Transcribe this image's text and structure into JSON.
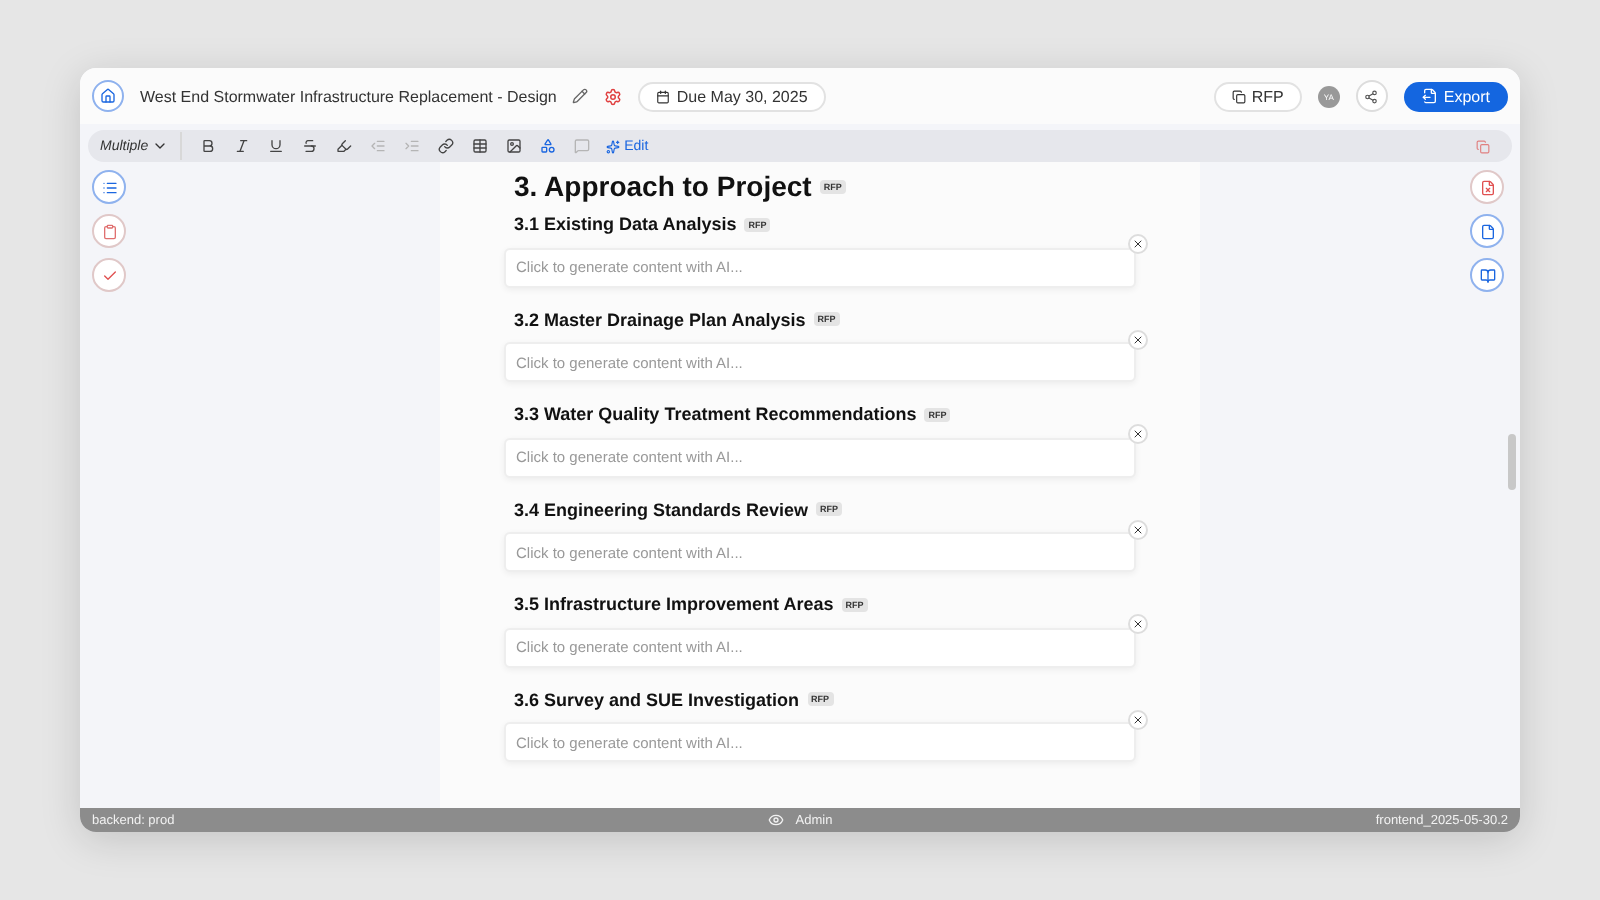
{
  "header": {
    "title": "West End Stormwater Infrastructure Replacement - Design",
    "due": "Due May 30, 2025",
    "rfp_button": "RFP",
    "avatar": "YA",
    "export_button": "Export"
  },
  "toolbar": {
    "style_select": "Multiple",
    "tools": [
      {
        "kind": "bold",
        "disabled": false
      },
      {
        "kind": "italic",
        "disabled": false
      },
      {
        "kind": "underline",
        "disabled": false
      },
      {
        "kind": "strike",
        "disabled": false
      },
      {
        "kind": "highlight",
        "disabled": false
      },
      {
        "kind": "outdent",
        "disabled": true
      },
      {
        "kind": "indent",
        "disabled": true
      },
      {
        "kind": "link",
        "disabled": false
      },
      {
        "kind": "table",
        "disabled": false
      },
      {
        "kind": "image",
        "disabled": false
      },
      {
        "kind": "shapes",
        "disabled": false
      },
      {
        "kind": "comment",
        "disabled": true
      }
    ],
    "edit_button": "Edit"
  },
  "document": {
    "title": "3. Approach to Project",
    "title_tag": "RFP",
    "sections": [
      {
        "heading": "3.1 Existing Data Analysis",
        "tag": "RFP",
        "placeholder": "Click to generate content with AI..."
      },
      {
        "heading": "3.2 Master Drainage Plan Analysis",
        "tag": "RFP",
        "placeholder": "Click to generate content with AI..."
      },
      {
        "heading": "3.3 Water Quality Treatment Recommendations",
        "tag": "RFP",
        "placeholder": "Click to generate content with AI..."
      },
      {
        "heading": "3.4 Engineering Standards Review",
        "tag": "RFP",
        "placeholder": "Click to generate content with AI..."
      },
      {
        "heading": "3.5 Infrastructure Improvement Areas",
        "tag": "RFP",
        "placeholder": "Click to generate content with AI..."
      },
      {
        "heading": "3.6 Survey and SUE Investigation",
        "tag": "RFP",
        "placeholder": "Click to generate content with AI..."
      }
    ]
  },
  "status_bar": {
    "left": "backend: prod",
    "center": "Admin",
    "right": "frontend_2025-05-30.2"
  }
}
